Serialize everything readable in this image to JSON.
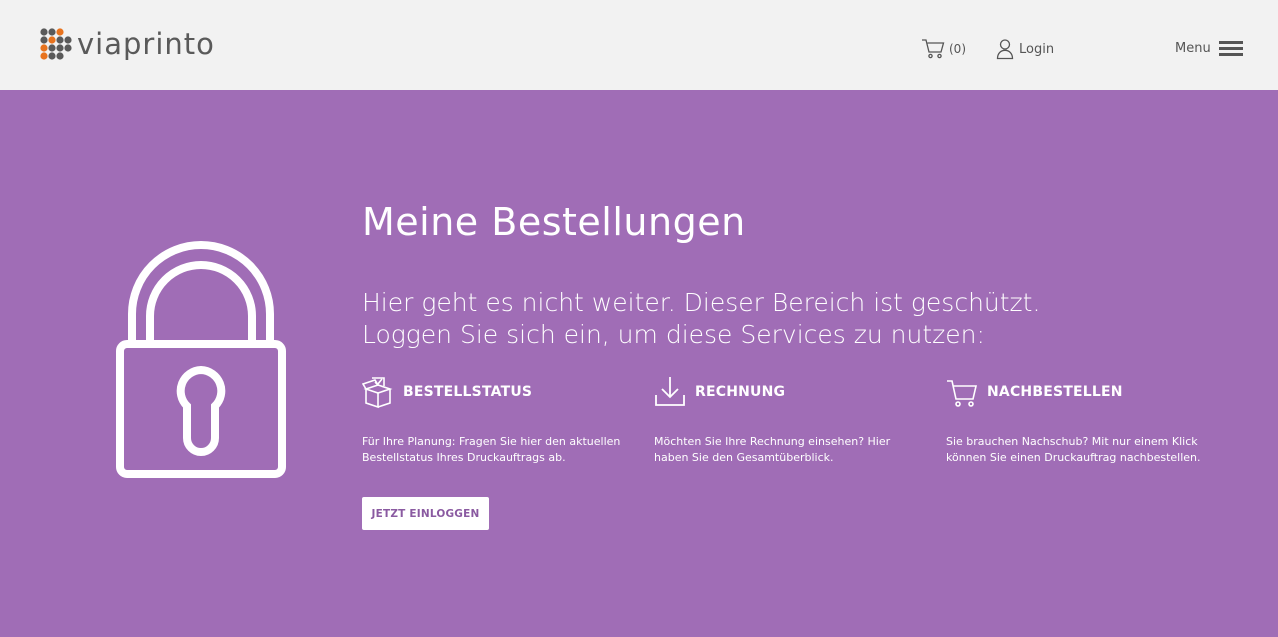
{
  "header": {
    "logo_text": "viaprinto",
    "cart_count": "(0)",
    "login_label": "Login",
    "menu_label": "Menu"
  },
  "hero": {
    "title": "Meine Bestellungen",
    "subtitle_line1": "Hier geht es nicht weiter. Dieser Bereich ist geschützt.",
    "subtitle_line2": "Loggen Sie sich ein, um diese Services zu nutzen:",
    "features": [
      {
        "icon": "box-check-icon",
        "title": "BESTELLSTATUS",
        "text": "Für Ihre Planung: Fragen Sie hier den aktuellen Bestellstatus Ihres Druckauftrags ab."
      },
      {
        "icon": "download-icon",
        "title": "RECHNUNG",
        "text": "Möchten Sie Ihre Rechnung einsehen? Hier haben Sie den Gesamtüberblick."
      },
      {
        "icon": "cart-icon",
        "title": "NACHBESTELLEN",
        "text": "Sie brauchen Nachschub? Mit nur einem Klick können Sie einen Druckauftrag nachbestellen."
      }
    ],
    "cta_label": "JETZT EINLOGGEN"
  },
  "colors": {
    "header_bg": "#f2f2f2",
    "hero_bg": "#a06db6",
    "logo_orange": "#e8731e",
    "logo_grey": "#5a5a5a",
    "cta_text": "#8a5aa1"
  }
}
